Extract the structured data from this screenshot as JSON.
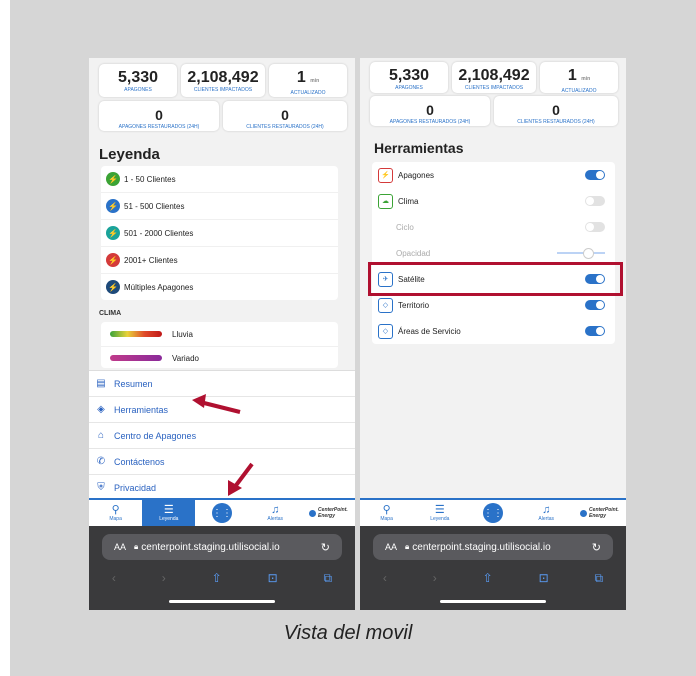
{
  "stats": {
    "outages": {
      "value": "5,330",
      "label": "APAGONES"
    },
    "customers": {
      "value": "2,108,492",
      "label": "CLIENTES IMPACTADOS"
    },
    "updated": {
      "value": "1",
      "unit": "min",
      "label": "ACTUALIZADO"
    },
    "restored_outages": {
      "value": "0",
      "label": "APAGONES RESTAURADOS (24h)"
    },
    "restored_customers": {
      "value": "0",
      "label": "CLIENTES RESTAURADOS (24h)"
    }
  },
  "legend": {
    "title": "Leyenda",
    "items": [
      {
        "label": "1 - 50 Clientes",
        "color": "#3ba335"
      },
      {
        "label": "51 - 500 Clientes",
        "color": "#2a72c8"
      },
      {
        "label": "501 - 2000 Clientes",
        "color": "#1aa39a"
      },
      {
        "label": "2001+ Clientes",
        "color": "#d43a3a"
      },
      {
        "label": "Múltiples Apagones",
        "color": "#1e4a7a"
      }
    ],
    "weather_heading": "CLIMA",
    "weather": [
      {
        "label": "Lluvia"
      },
      {
        "label": "Variado"
      }
    ]
  },
  "menu": {
    "items": [
      {
        "label": "Resumen",
        "icon": "list-icon"
      },
      {
        "label": "Herramientas",
        "icon": "layers-icon"
      },
      {
        "label": "Centro de Apagones",
        "icon": "outage-center-icon"
      },
      {
        "label": "Contáctenos",
        "icon": "phone-icon"
      },
      {
        "label": "Privacidad",
        "icon": "shield-icon"
      }
    ]
  },
  "tabbar": {
    "map": "Mapa",
    "legend": "Leyenda",
    "alerts": "Alertas",
    "brand_line1": "CenterPoint.",
    "brand_line2": "Energy"
  },
  "browser": {
    "aa": "AA",
    "url": "centerpoint.staging.utilisocial.io"
  },
  "tools": {
    "title": "Herramientas",
    "items": [
      {
        "label": "Apagones",
        "state": "on"
      },
      {
        "label": "Clima",
        "state": "off"
      },
      {
        "label": "Ciclo",
        "state": "off",
        "disabled": true
      },
      {
        "label": "Opacidad",
        "state": "slider",
        "disabled": true,
        "value": 0.55
      },
      {
        "label": "Satélite",
        "state": "on"
      },
      {
        "label": "Territorio",
        "state": "on"
      },
      {
        "label": "Áreas de Servicio",
        "state": "on"
      }
    ]
  },
  "caption": "Vista del movil",
  "colors": {
    "accent": "#2a72c8",
    "highlight": "#b01030"
  }
}
